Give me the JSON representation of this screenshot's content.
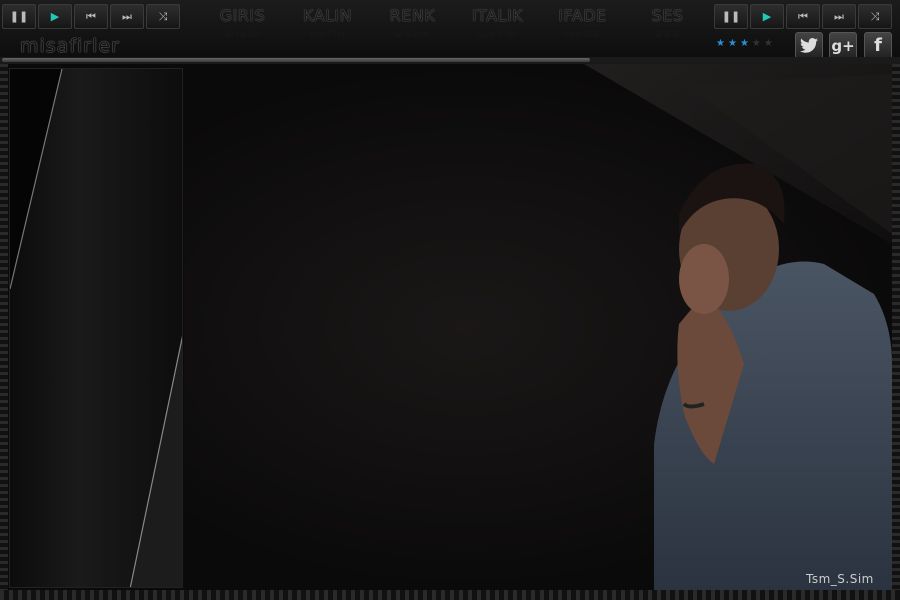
{
  "player_left": {
    "buttons": [
      {
        "name": "pause-button",
        "icon": "pause-icon",
        "glyph": "❚❚"
      },
      {
        "name": "play-button",
        "icon": "play-icon",
        "glyph": "▶"
      },
      {
        "name": "previous-button",
        "icon": "previous-icon",
        "glyph": "⏮"
      },
      {
        "name": "next-button",
        "icon": "next-icon",
        "glyph": "⏭"
      },
      {
        "name": "shuffle-button",
        "icon": "shuffle-icon",
        "glyph": "⤨"
      }
    ]
  },
  "player_right": {
    "buttons": [
      {
        "name": "pause-button",
        "icon": "pause-icon",
        "glyph": "❚❚"
      },
      {
        "name": "play-button",
        "icon": "play-icon",
        "glyph": "▶"
      },
      {
        "name": "previous-button",
        "icon": "previous-icon",
        "glyph": "⏮"
      },
      {
        "name": "next-button",
        "icon": "next-icon",
        "glyph": "⏭"
      },
      {
        "name": "shuffle-button",
        "icon": "shuffle-icon",
        "glyph": "⤨"
      }
    ]
  },
  "menu": {
    "items": [
      "GIRIS",
      "KALIN",
      "RENK",
      "ITALIK",
      "IFADE",
      "SES"
    ]
  },
  "guest_label": "misafirler",
  "rating": {
    "filled": 3,
    "total": 5
  },
  "social": {
    "twitter_icon": "twitter-icon",
    "googleplus_label": "g+",
    "facebook_label": "f"
  },
  "colors": {
    "accent": "#1fc8b8",
    "star": "#2a8fd6"
  },
  "credit": "Tsm_S.Sim"
}
